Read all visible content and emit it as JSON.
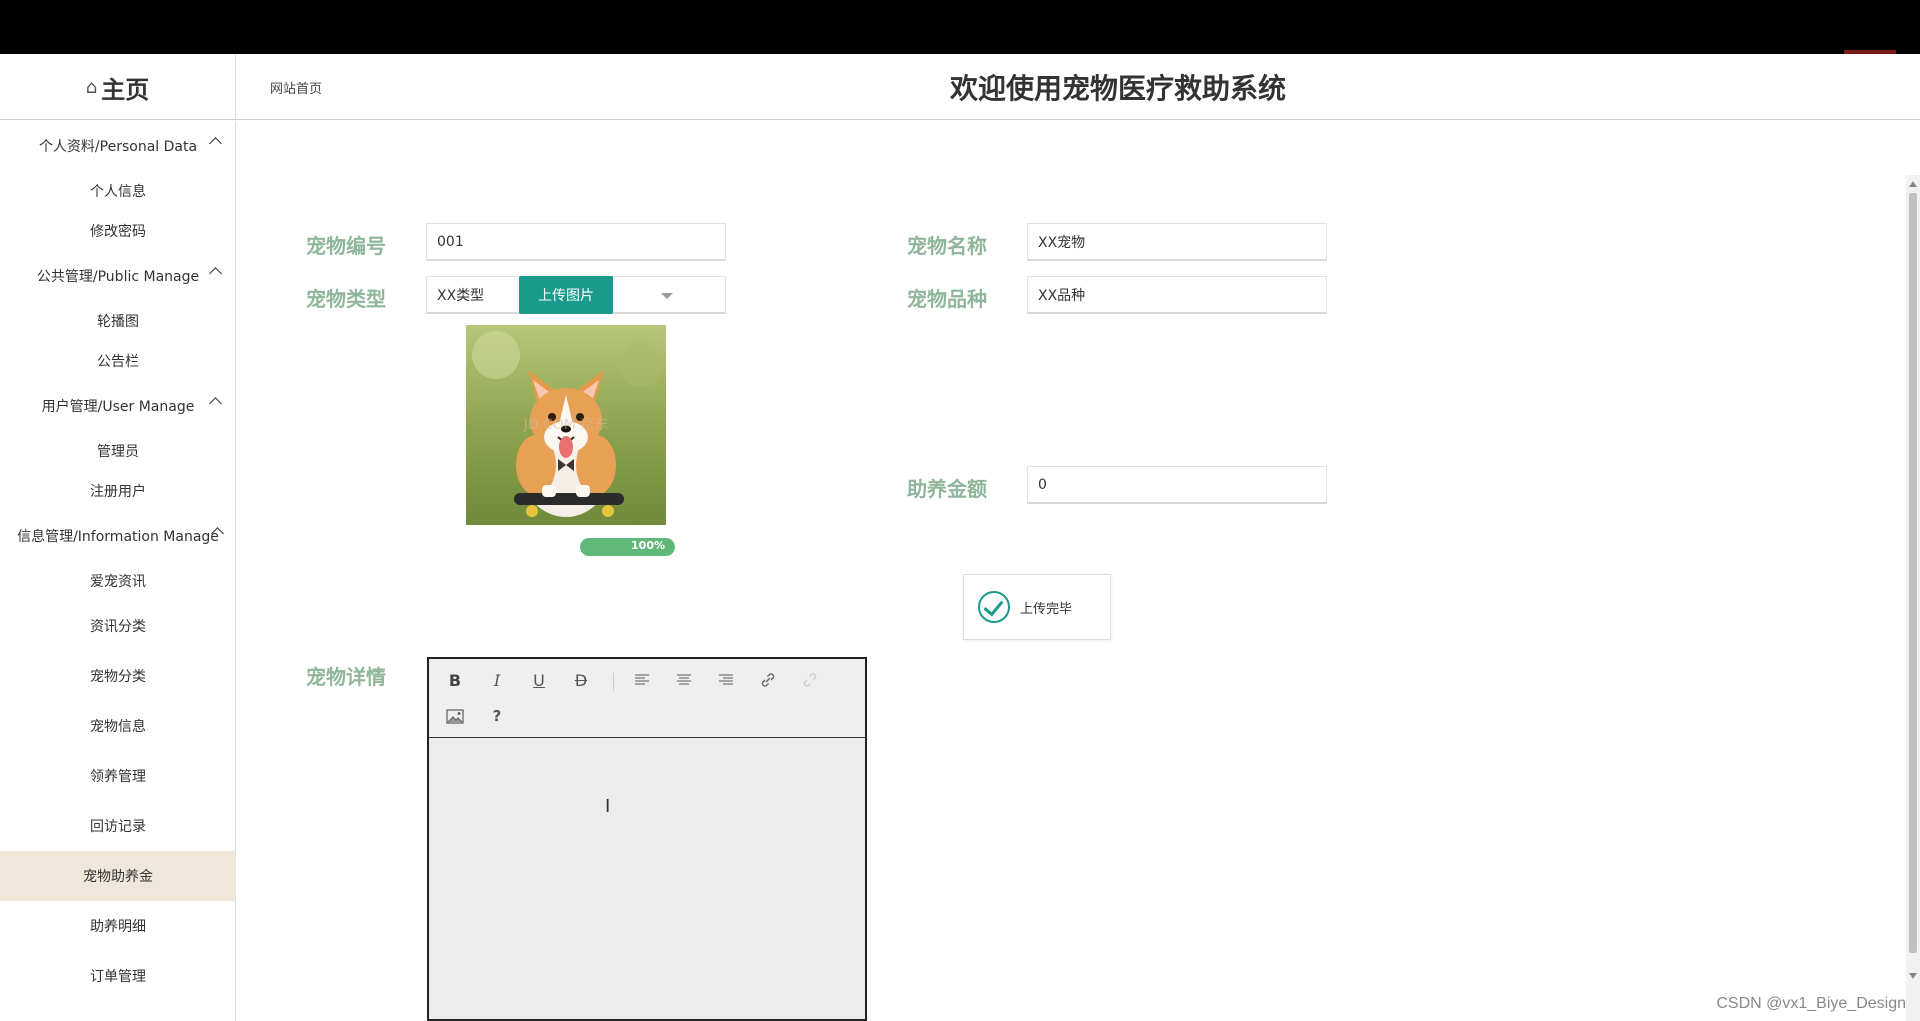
{
  "header": {
    "home_icon": "home-icon",
    "home_label": "主页",
    "breadcrumb": "网站首页",
    "site_title": "欢迎使用宠物医疗救助系统"
  },
  "sidebar": {
    "groups": [
      {
        "title": "个人资料/Personal Data",
        "items": [
          "个人信息",
          "修改密码"
        ]
      },
      {
        "title": "公共管理/Public Manage",
        "items": [
          "轮播图",
          "公告栏"
        ]
      },
      {
        "title": "用户管理/User Manage",
        "items": [
          "管理员",
          "注册用户"
        ]
      },
      {
        "title": "信息管理/Information Manage",
        "items": [
          "爱宠资讯",
          "资讯分类",
          "宠物分类",
          "宠物信息",
          "领养管理",
          "回访记录",
          "宠物助养金",
          "助养明细",
          "订单管理"
        ]
      }
    ],
    "active_item": "宠物助养金"
  },
  "form": {
    "pet_no": {
      "label": "宠物编号",
      "value": "001"
    },
    "pet_name": {
      "label": "宠物名称",
      "value": "XX宠物"
    },
    "pet_type": {
      "label": "宠物类型",
      "value": "XX类型"
    },
    "pet_breed": {
      "label": "宠物品种",
      "value": "XX品种"
    },
    "upload_button": "上传图片",
    "upload_progress_label": "100%",
    "upload_progress": 1.0,
    "sponsor_amount": {
      "label": "助养金额",
      "value": "0"
    },
    "pet_detail": {
      "label": "宠物详情"
    }
  },
  "toast": {
    "icon": "check-circle-icon",
    "message": "上传完毕"
  },
  "editor": {
    "toolbar": [
      {
        "name": "bold-button",
        "glyph": "B"
      },
      {
        "name": "italic-button",
        "glyph": "I"
      },
      {
        "name": "underline-button",
        "glyph": "U"
      },
      {
        "name": "strikethrough-button",
        "glyph": "D"
      },
      {
        "name": "align-left-button",
        "glyph": "≡"
      },
      {
        "name": "align-center-button",
        "glyph": "≡"
      },
      {
        "name": "align-right-button",
        "glyph": "≡"
      },
      {
        "name": "link-button",
        "glyph": "🔗"
      },
      {
        "name": "unlink-button",
        "glyph": "⛓"
      },
      {
        "name": "image-button",
        "glyph": "▨"
      },
      {
        "name": "help-button",
        "glyph": "?"
      }
    ]
  },
  "photo": {
    "watermark": "JD.COM 京东"
  },
  "watermark": "CSDN @vx1_Biye_Design",
  "colors": {
    "accent": "#1a9a8a",
    "label": "#8fb69a",
    "active_bg": "#efe7d9",
    "progress": "#5fb878"
  }
}
